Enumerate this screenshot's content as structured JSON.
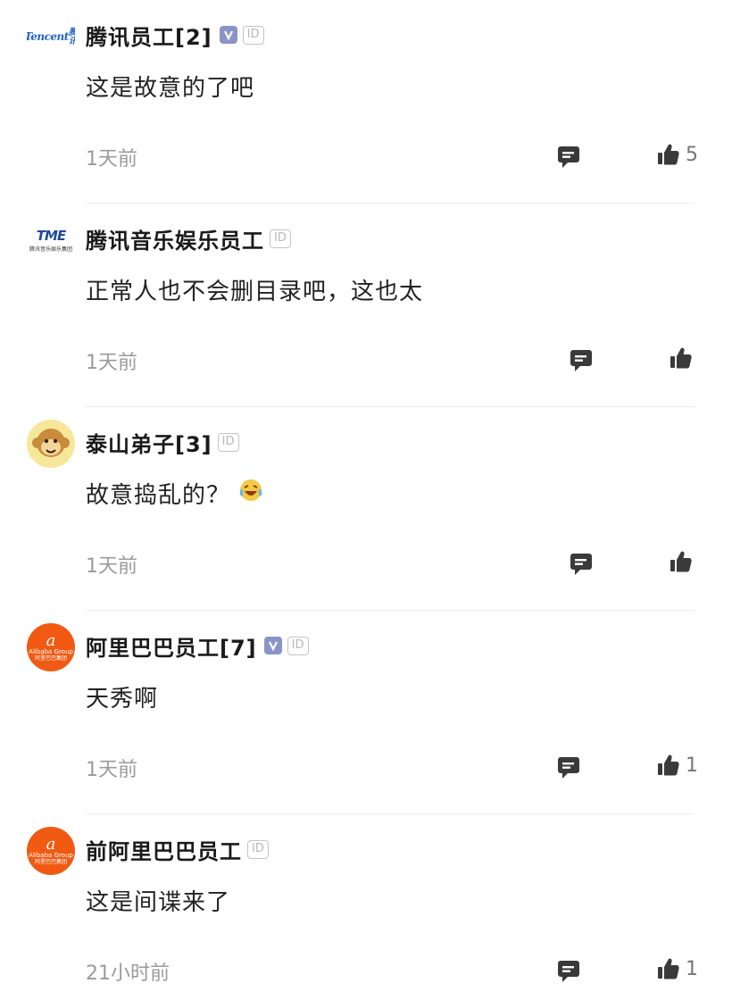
{
  "comments": [
    {
      "user": "腾讯员工[2]",
      "verified": true,
      "id_badge": "ID",
      "content": "这是故意的了吧",
      "time": "1天前",
      "likes": "5",
      "avatar": {
        "type": "tencent",
        "text_en": "Tencent",
        "text_cn": "腾讯"
      }
    },
    {
      "user": "腾讯音乐娱乐员工",
      "verified": false,
      "id_badge": "ID",
      "content": "正常人也不会删目录吧，这也太",
      "time": "1天前",
      "likes": "",
      "avatar": {
        "type": "tme",
        "mark": "TME",
        "sub": "腾讯音乐娱乐集团"
      }
    },
    {
      "user": "泰山弟子[3]",
      "verified": false,
      "id_badge": "ID",
      "content": "故意捣乱的？",
      "emoji": "laughing-crying-emoji",
      "time": "1天前",
      "likes": "",
      "avatar": {
        "type": "monkey"
      }
    },
    {
      "user": "阿里巴巴员工[7]",
      "verified": true,
      "id_badge": "ID",
      "content": "天秀啊",
      "time": "1天前",
      "likes": "1",
      "avatar": {
        "type": "alibaba",
        "text_en": "Alibaba Group",
        "text_cn": "阿里巴巴集团"
      }
    },
    {
      "user": "前阿里巴巴员工",
      "verified": false,
      "id_badge": "ID",
      "content": "这是间谍来了",
      "time": "21小时前",
      "likes": "1",
      "avatar": {
        "type": "alibaba",
        "text_en": "Alibaba Group",
        "text_cn": "阿里巴巴集团"
      }
    }
  ],
  "icons": {
    "reply": "comment-bubble-icon",
    "like": "thumbs-up-icon",
    "verified": "verified-v-icon"
  },
  "colors": {
    "icon": "#3a3a3a",
    "time": "#9b9b9b",
    "verified": "#8b94c9",
    "alibaba": "#f05a12",
    "tencent": "#1f62c9"
  }
}
